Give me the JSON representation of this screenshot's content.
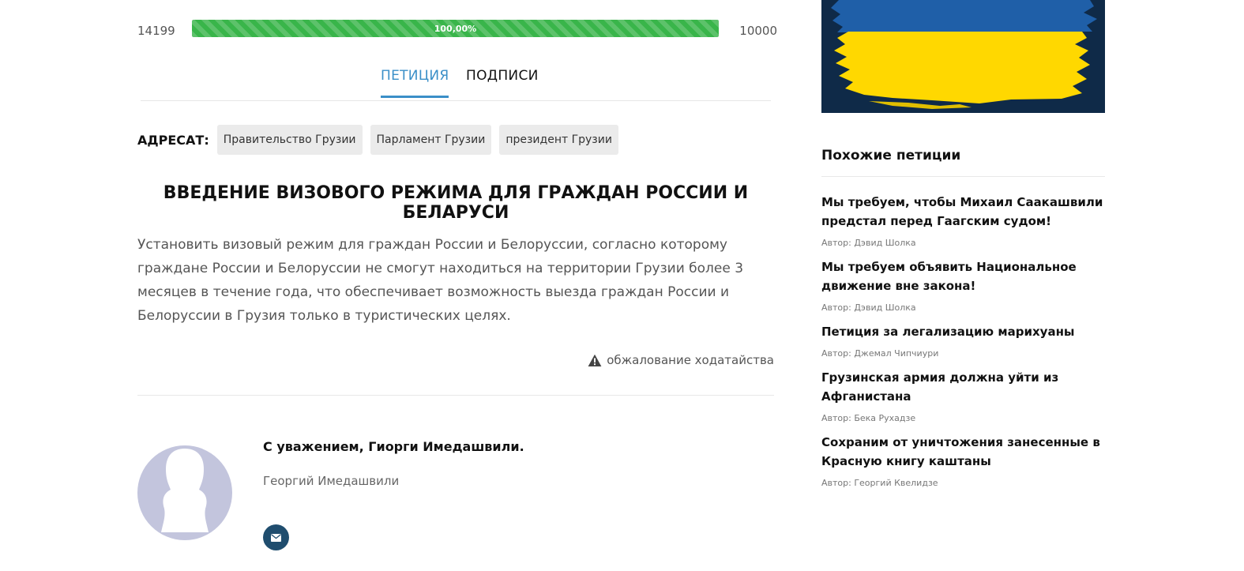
{
  "progress": {
    "signatures_count": "14199",
    "target": "10000",
    "percent_label": "100,00%",
    "fill_fraction": 1.0,
    "color": "#39b54a"
  },
  "tabs": [
    {
      "label": "ПЕТИЦИЯ",
      "active": true
    },
    {
      "label": "ПОДПИСИ",
      "active": false
    }
  ],
  "addressee": {
    "label": "АДРЕСАТ:",
    "chips": [
      "Правительство Грузии",
      "Парламент Грузии",
      "президент Грузии"
    ]
  },
  "petition": {
    "title": "ВВЕДЕНИЕ ВИЗОВОГО РЕЖИМА ДЛЯ ГРАЖДАН РОССИИ И БЕЛАРУСИ",
    "body": "Установить визовый режим для граждан России и Белоруссии, согласно которому граждане России и Белоруссии не смогут находиться на территории Грузии более 3 месяцев в течение года, что обеспечивает возможность выезда граждан России и Белоруссии в Грузия только в туристических целях.",
    "complaint_label": "обжалование ходатайства",
    "complaint_icon": "warning-triangle-icon"
  },
  "author": {
    "regards": "С уважением, Гиорги Имедашвили.",
    "name": "Георгий Имедашвили",
    "contact_icon": "envelope-icon"
  },
  "sidebar": {
    "banner": "ukraine-flag",
    "title": "Похожие петиции",
    "items": [
      {
        "title": "Мы требуем, чтобы Михаил Саакашвили предстал перед Гаагским судом!",
        "author": "Автор: Дэвид Шолка"
      },
      {
        "title": "Мы требуем объявить Национальное движение вне закона!",
        "author": "Автор: Дэвид Шолка"
      },
      {
        "title": "Петиция за легализацию марихуаны",
        "author": "Автор: Джемал Чипчиури"
      },
      {
        "title": "Грузинская армия должна уйти из Афганистана",
        "author": "Автор: Бека Рухадзе"
      },
      {
        "title": "Сохраним от уничтожения занесенные в Красную книгу каштаны",
        "author": "Автор: Георгий Квелидзе"
      }
    ]
  },
  "colors": {
    "accent": "#3a8fc8",
    "progress": "#39b54a",
    "contact_button": "#1f4d6e",
    "avatar": "#c3c5dd",
    "flag_blue": "#1f5fa8",
    "flag_yellow": "#ffd800"
  }
}
